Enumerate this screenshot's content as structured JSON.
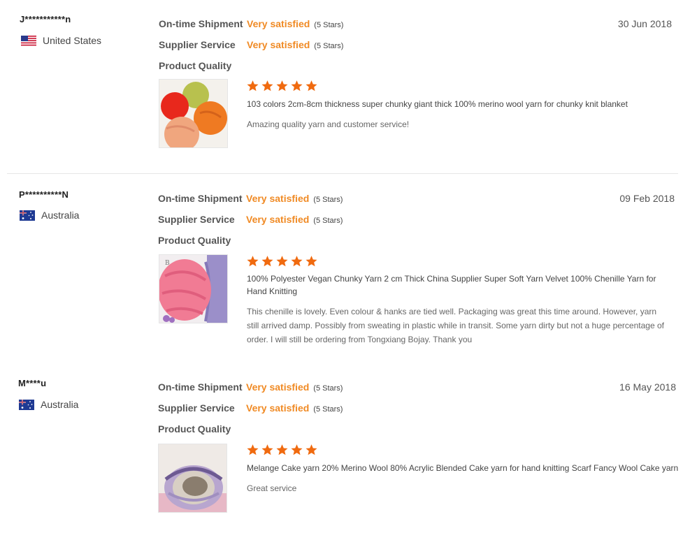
{
  "labels": {
    "ontime": "On-time Shipment",
    "supplier": "Supplier Service",
    "quality": "Product Quality"
  },
  "colors": {
    "accent": "#f08a24",
    "star": "#f06a0f"
  },
  "reviews": [
    {
      "buyer": "J***********n",
      "country": "United States",
      "flag": "us-flag-icon",
      "date": "30 Jun 2018",
      "ontime_value": "Very satisfied",
      "ontime_stars": "(5 Stars)",
      "supplier_value": "Very satisfied",
      "supplier_stars": "(5 Stars)",
      "rating": 5,
      "product_title": "103 colors 2cm-8cm thickness super chunky giant thick 100% merino wool yarn for chunky knit blanket",
      "feedback": "Amazing quality yarn and customer service!"
    },
    {
      "buyer": "P**********N",
      "country": "Australia",
      "flag": "au-flag-icon",
      "date": "09 Feb 2018",
      "ontime_value": "Very satisfied",
      "ontime_stars": "(5 Stars)",
      "supplier_value": "Very satisfied",
      "supplier_stars": "(5 Stars)",
      "rating": 5,
      "product_title": "100% Polyester Vegan Chunky Yarn 2 cm Thick China Supplier Super Soft Yarn Velvet 100% Chenille Yarn for Hand Knitting",
      "feedback": "This chenille is lovely. Even colour & hanks are tied well. Packaging was great this time around. However, yarn still arrived damp. Possibly from sweating in plastic while in transit. Some yarn dirty but not a huge percentage of order. I will still be ordering from Tongxiang Bojay. Thank you"
    },
    {
      "buyer": "M****u",
      "country": "Australia",
      "flag": "au-flag-icon",
      "date": "16 May 2018",
      "ontime_value": "Very satisfied",
      "ontime_stars": "(5 Stars)",
      "supplier_value": "Very satisfied",
      "supplier_stars": "(5 Stars)",
      "rating": 5,
      "product_title": "Melange Cake yarn 20% Merino Wool 80% Acrylic Blended Cake yarn for hand knitting Scarf Fancy Wool Cake yarn",
      "feedback": "Great service"
    }
  ]
}
